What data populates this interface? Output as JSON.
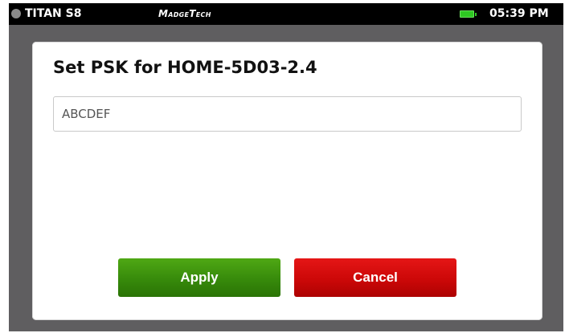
{
  "status_bar": {
    "device_name": "TITAN S8",
    "brand": "MadgeTech",
    "battery_icon": "battery-full-icon",
    "battery_color": "#2ec822",
    "time": "05:39 PM"
  },
  "dialog": {
    "title": "Set PSK for HOME-5D03-2.4",
    "psk_input": {
      "value": "ABCDEF",
      "placeholder": ""
    },
    "apply_label": "Apply",
    "cancel_label": "Cancel"
  },
  "colors": {
    "apply": "#378a0b",
    "cancel": "#cc0808",
    "background": "#5f5e60",
    "status_bar": "#000000"
  }
}
